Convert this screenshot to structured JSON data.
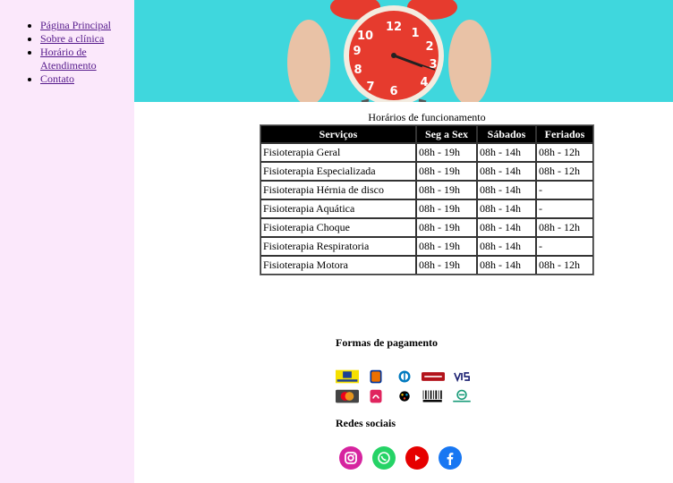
{
  "nav": {
    "items": [
      {
        "label": "Página Principal"
      },
      {
        "label": "Sobre a clínica"
      },
      {
        "label": "Horário de Atendimento"
      },
      {
        "label": "Contato"
      }
    ]
  },
  "schedule": {
    "caption": "Horários de funcionamento",
    "headers": [
      "Serviços",
      "Seg a Sex",
      "Sábados",
      "Feriados"
    ],
    "rows": [
      [
        "Fisioterapia Geral",
        "08h - 19h",
        "08h - 14h",
        "08h - 12h"
      ],
      [
        "Fisioterapia Especializada",
        "08h - 19h",
        "08h - 14h",
        "08h - 12h"
      ],
      [
        "Fisioterapia Hérnia de disco",
        "08h - 19h",
        "08h - 14h",
        "-"
      ],
      [
        "Fisioterapia Aquática",
        "08h - 19h",
        "08h - 14h",
        "-"
      ],
      [
        "Fisioterapia Choque",
        "08h - 19h",
        "08h - 14h",
        "08h - 12h"
      ],
      [
        "Fisioterapia Respiratoria",
        "08h - 19h",
        "08h - 14h",
        "-"
      ],
      [
        "Fisioterapia Motora",
        "08h - 19h",
        "08h - 14h",
        "08h - 12h"
      ]
    ]
  },
  "payment": {
    "title": "Formas de pagamento",
    "methods": [
      {
        "icon": "banco-do-brasil-icon",
        "color": "#f5e000"
      },
      {
        "icon": "itau-icon",
        "color": "#ec7000"
      },
      {
        "icon": "diners-icon",
        "color": "#0079be"
      },
      {
        "icon": "hipercard-icon",
        "color": "#b3131b"
      },
      {
        "icon": "visa-icon",
        "color": "#1a1f71"
      },
      {
        "icon": "mastercard-icon",
        "color": "#eb001b"
      },
      {
        "icon": "hiper-icon",
        "color": "#e0245e"
      },
      {
        "icon": "elo-icon",
        "color": "#000000"
      },
      {
        "icon": "boleto-icon",
        "color": "#000000"
      },
      {
        "icon": "transferencia-icon",
        "color": "#1a9c7a"
      }
    ]
  },
  "social": {
    "title": "Redes sociais",
    "links": [
      {
        "icon": "instagram-icon",
        "color": "#d6249f"
      },
      {
        "icon": "whatsapp-icon",
        "color": "#25d366"
      },
      {
        "icon": "youtube-icon",
        "color": "#e60000"
      },
      {
        "icon": "facebook-icon",
        "color": "#1877f2"
      }
    ]
  },
  "banner": {
    "icon": "alarm-clock-icon",
    "background": "#3fd7dd",
    "clock_face": "#e63b2e"
  }
}
